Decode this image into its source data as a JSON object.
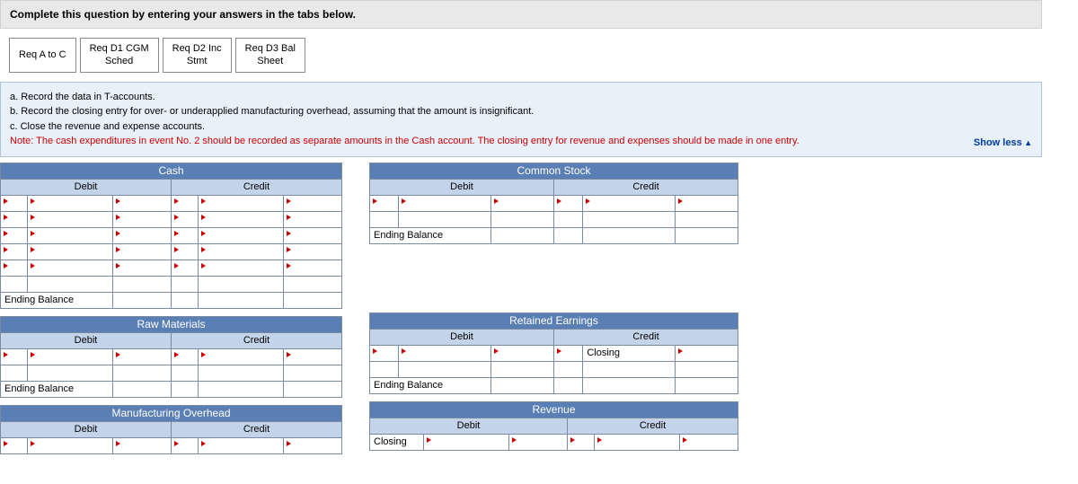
{
  "header": {
    "instruction": "Complete this question by entering your answers in the tabs below."
  },
  "tabs": [
    {
      "label": "Req A to C"
    },
    {
      "label": "Req D1 CGM\nSched"
    },
    {
      "label": "Req D2 Inc\nStmt"
    },
    {
      "label": "Req D3 Bal\nSheet"
    }
  ],
  "infobox": {
    "line_a": "a. Record the data in T-accounts.",
    "line_b": "b. Record the closing entry for over- or underapplied manufacturing overhead, assuming that the amount is insignificant.",
    "line_c": "c. Close the revenue and expense accounts.",
    "note": "Note: The cash expenditures in event No. 2 should be recorded as separate amounts in the Cash account. The closing entry for revenue and expenses should be made in one entry.",
    "show_less": "Show less"
  },
  "labels": {
    "debit": "Debit",
    "credit": "Credit",
    "ending_balance": "Ending Balance",
    "closing": "Closing"
  },
  "accounts": {
    "cash": {
      "title": "Cash"
    },
    "raw_materials": {
      "title": "Raw Materials"
    },
    "manufacturing_overhead": {
      "title": "Manufacturing Overhead"
    },
    "common_stock": {
      "title": "Common Stock"
    },
    "retained_earnings": {
      "title": "Retained Earnings"
    },
    "revenue": {
      "title": "Revenue"
    }
  }
}
